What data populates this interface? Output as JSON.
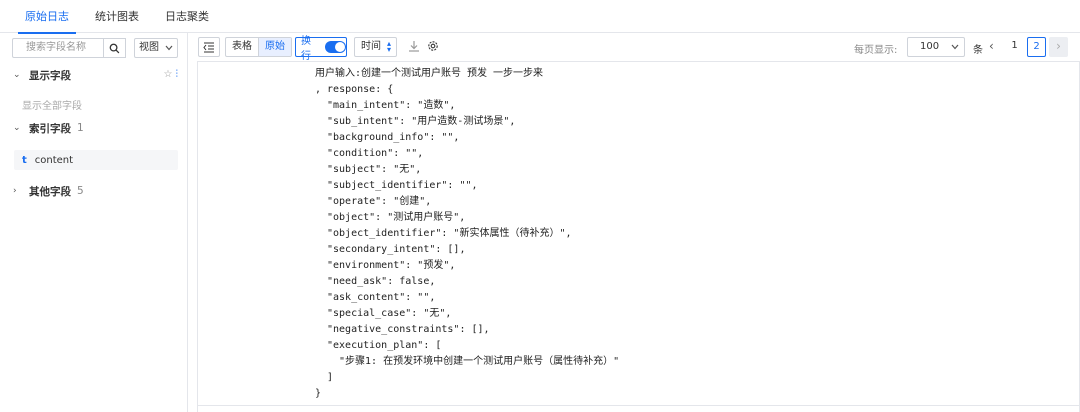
{
  "tabs": [
    {
      "label": "原始日志",
      "active": true
    },
    {
      "label": "统计图表",
      "active": false
    },
    {
      "label": "日志聚类",
      "active": false
    }
  ],
  "sidebar": {
    "search_placeholder": "搜索字段名称",
    "view_label": "视图",
    "displayed_section": {
      "label": "显示字段"
    },
    "show_all_label": "显示全部字段",
    "indexed_section": {
      "label": "索引字段",
      "count": "1"
    },
    "indexed_fields": [
      {
        "type": "t",
        "name": "content"
      }
    ],
    "other_section": {
      "label": "其他字段",
      "count": "5"
    }
  },
  "toolbar": {
    "table_label": "表格",
    "raw_label": "原始",
    "wrap_label": "换行",
    "wrap_on": true,
    "time_label": "时间",
    "per_page_label": "每页显示:",
    "page_size": "100",
    "unit_label": "条",
    "pages": [
      "1",
      "2"
    ],
    "current_page": "2"
  },
  "log_lines": [
    {
      "indent": 0,
      "text": "用户输入:创建一个测试用户账号 预发 一步一步来"
    },
    {
      "indent": 0,
      "text": ", response: {"
    },
    {
      "indent": 1,
      "text": "\"main_intent\": \"造数\","
    },
    {
      "indent": 1,
      "text": "\"sub_intent\": \"用户造数-测试场景\","
    },
    {
      "indent": 1,
      "text": "\"background_info\": \"\","
    },
    {
      "indent": 1,
      "text": "\"condition\": \"\","
    },
    {
      "indent": 1,
      "text": "\"subject\": \"无\","
    },
    {
      "indent": 1,
      "text": "\"subject_identifier\": \"\","
    },
    {
      "indent": 1,
      "text": "\"operate\": \"创建\","
    },
    {
      "indent": 1,
      "text": "\"object\": \"测试用户账号\","
    },
    {
      "indent": 1,
      "text": "\"object_identifier\": \"新实体属性（待补充）\","
    },
    {
      "indent": 1,
      "text": "\"secondary_intent\": [],"
    },
    {
      "indent": 1,
      "text": "\"environment\": \"预发\","
    },
    {
      "indent": 1,
      "text": "\"need_ask\": false,"
    },
    {
      "indent": 1,
      "text": "\"ask_content\": \"\","
    },
    {
      "indent": 1,
      "text": "\"special_case\": \"无\","
    },
    {
      "indent": 1,
      "text": "\"negative_constraints\": [],"
    },
    {
      "indent": 1,
      "text": "\"execution_plan\": ["
    },
    {
      "indent": 2,
      "text": "\"步骤1: 在预发环境中创建一个测试用户账号（属性待补充）\""
    },
    {
      "indent": 1,
      "text": "]"
    },
    {
      "indent": 0,
      "text": "}"
    }
  ]
}
